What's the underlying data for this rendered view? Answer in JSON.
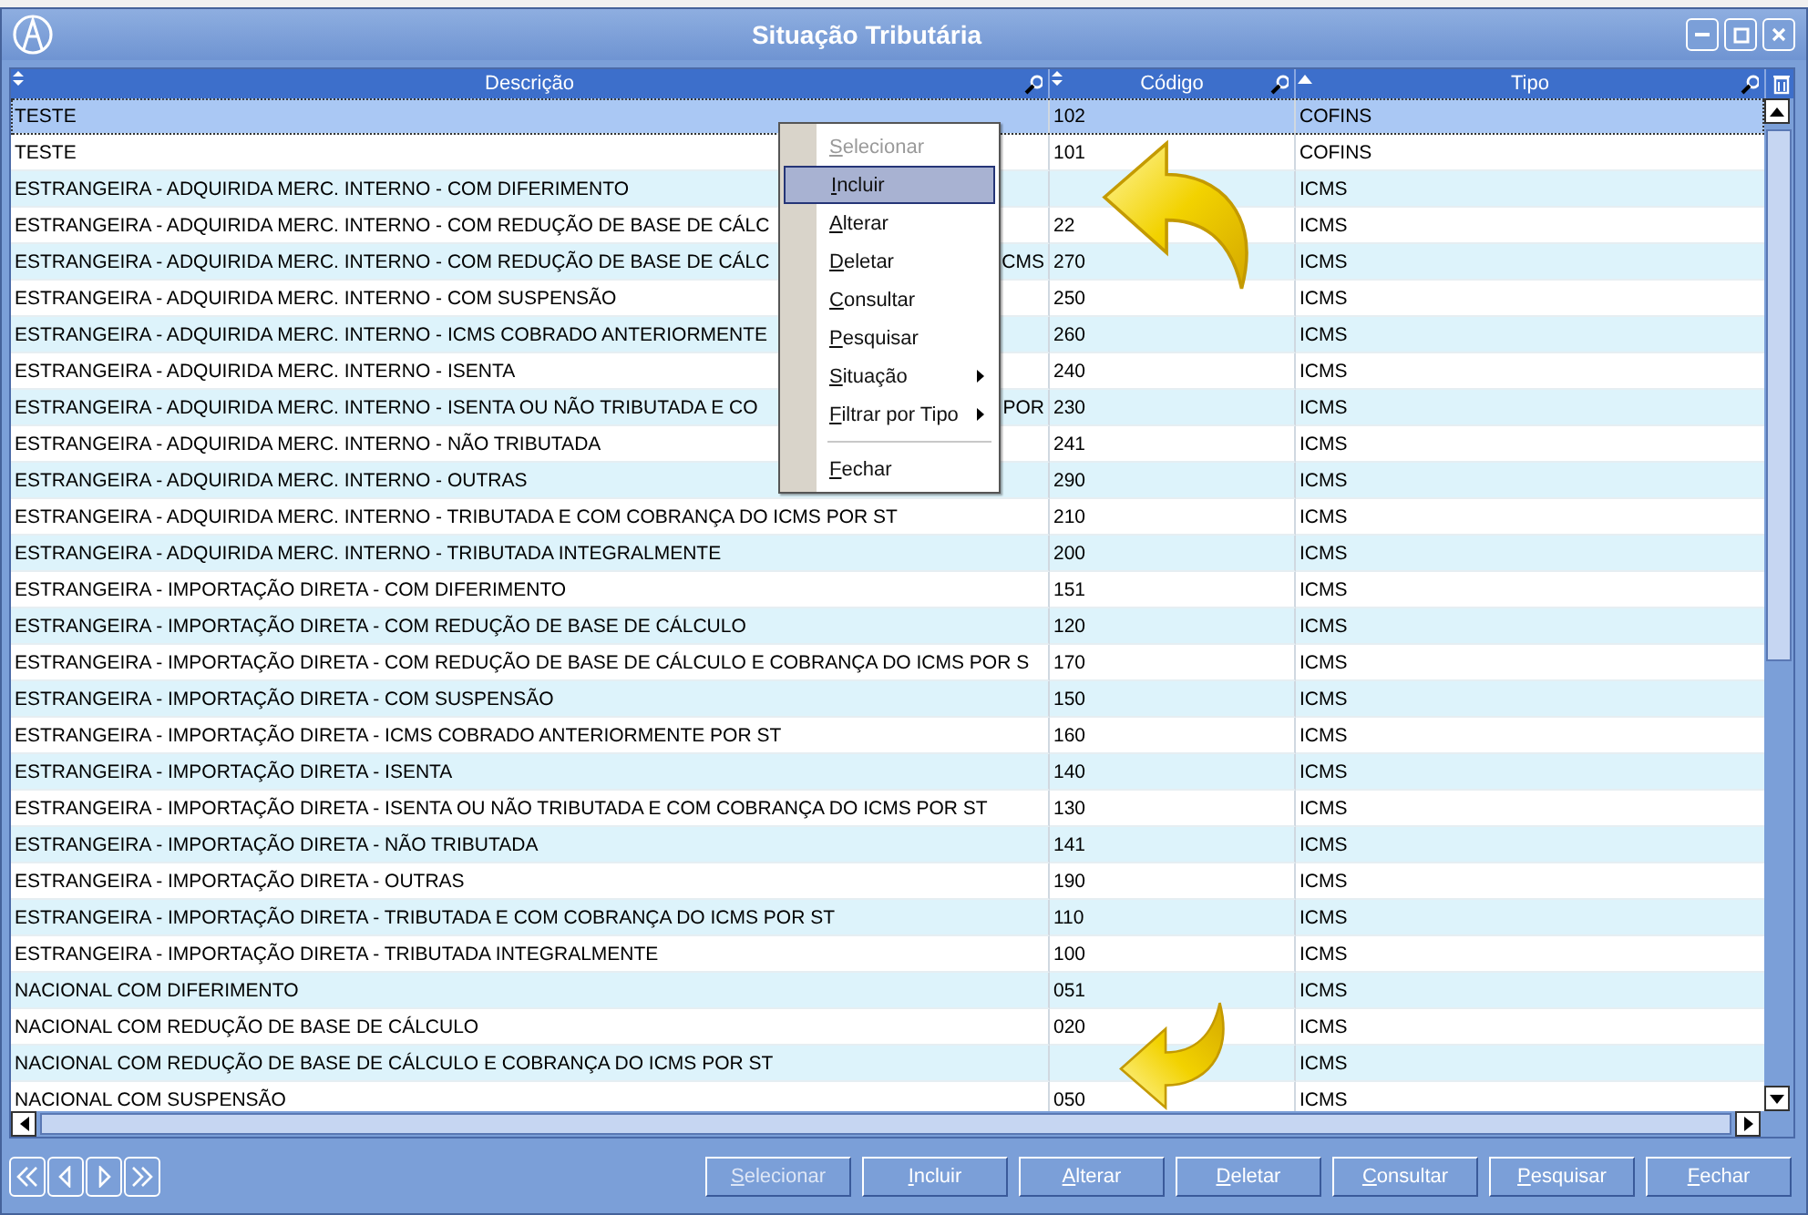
{
  "window": {
    "title": "Situação Tributária"
  },
  "table": {
    "columns": [
      {
        "label": "Descrição"
      },
      {
        "label": "Código"
      },
      {
        "label": "Tipo",
        "sorted": true
      }
    ],
    "rows": [
      {
        "description": "TESTE",
        "code": "102",
        "type": "COFINS",
        "selected": true
      },
      {
        "description": "TESTE",
        "code": "101",
        "type": "COFINS",
        "selected": false
      },
      {
        "description": "ESTRANGEIRA - ADQUIRIDA MERC. INTERNO - COM DIFERIMENTO",
        "type": "ICMS",
        "selected": false
      },
      {
        "description": "ESTRANGEIRA - ADQUIRIDA MERC. INTERNO - COM REDUÇÃO DE BASE DE CÁLC",
        "code": "22",
        "type": "ICMS",
        "selected": false
      },
      {
        "description": "ESTRANGEIRA - ADQUIRIDA MERC. INTERNO - COM REDUÇÃO DE BASE DE CÁLC",
        "description_tail": "CMS",
        "code": "270",
        "type": "ICMS",
        "selected": false
      },
      {
        "description": "ESTRANGEIRA - ADQUIRIDA MERC. INTERNO - COM SUSPENSÃO",
        "code": "250",
        "type": "ICMS",
        "selected": false
      },
      {
        "description": "ESTRANGEIRA - ADQUIRIDA MERC. INTERNO - ICMS COBRADO ANTERIORMENTE",
        "code": "260",
        "type": "ICMS",
        "selected": false
      },
      {
        "description": "ESTRANGEIRA - ADQUIRIDA MERC. INTERNO - ISENTA",
        "code": "240",
        "type": "ICMS",
        "selected": false
      },
      {
        "description": "ESTRANGEIRA - ADQUIRIDA MERC. INTERNO - ISENTA OU NÃO TRIBUTADA E CO",
        "description_tail": "POR",
        "code": "230",
        "type": "ICMS",
        "selected": false
      },
      {
        "description": "ESTRANGEIRA - ADQUIRIDA MERC. INTERNO - NÃO TRIBUTADA",
        "code": "241",
        "type": "ICMS",
        "selected": false
      },
      {
        "description": "ESTRANGEIRA - ADQUIRIDA MERC. INTERNO - OUTRAS",
        "code": "290",
        "type": "ICMS",
        "selected": false
      },
      {
        "description": "ESTRANGEIRA - ADQUIRIDA MERC. INTERNO - TRIBUTADA E COM COBRANÇA DO ICMS POR ST",
        "code": "210",
        "type": "ICMS",
        "selected": false
      },
      {
        "description": "ESTRANGEIRA - ADQUIRIDA MERC. INTERNO - TRIBUTADA INTEGRALMENTE",
        "code": "200",
        "type": "ICMS",
        "selected": false
      },
      {
        "description": "ESTRANGEIRA - IMPORTAÇÃO DIRETA - COM DIFERIMENTO",
        "code": "151",
        "type": "ICMS",
        "selected": false
      },
      {
        "description": "ESTRANGEIRA - IMPORTAÇÃO DIRETA - COM REDUÇÃO DE BASE DE CÁLCULO",
        "code": "120",
        "type": "ICMS",
        "selected": false
      },
      {
        "description": "ESTRANGEIRA - IMPORTAÇÃO DIRETA - COM REDUÇÃO DE BASE DE CÁLCULO E COBRANÇA DO ICMS POR S",
        "code": "170",
        "type": "ICMS",
        "selected": false
      },
      {
        "description": "ESTRANGEIRA - IMPORTAÇÃO DIRETA - COM SUSPENSÃO",
        "code": "150",
        "type": "ICMS",
        "selected": false
      },
      {
        "description": "ESTRANGEIRA - IMPORTAÇÃO DIRETA - ICMS COBRADO ANTERIORMENTE POR ST",
        "code": "160",
        "type": "ICMS",
        "selected": false
      },
      {
        "description": "ESTRANGEIRA - IMPORTAÇÃO DIRETA - ISENTA",
        "code": "140",
        "type": "ICMS",
        "selected": false
      },
      {
        "description": "ESTRANGEIRA - IMPORTAÇÃO DIRETA - ISENTA OU NÃO TRIBUTADA E COM COBRANÇA DO ICMS POR ST",
        "code": "130",
        "type": "ICMS",
        "selected": false
      },
      {
        "description": "ESTRANGEIRA - IMPORTAÇÃO DIRETA - NÃO TRIBUTADA",
        "code": "141",
        "type": "ICMS",
        "selected": false
      },
      {
        "description": "ESTRANGEIRA - IMPORTAÇÃO DIRETA - OUTRAS",
        "code": "190",
        "type": "ICMS",
        "selected": false
      },
      {
        "description": "ESTRANGEIRA - IMPORTAÇÃO DIRETA - TRIBUTADA E COM COBRANÇA DO ICMS POR ST",
        "code": "110",
        "type": "ICMS",
        "selected": false
      },
      {
        "description": "ESTRANGEIRA - IMPORTAÇÃO DIRETA - TRIBUTADA INTEGRALMENTE",
        "code": "100",
        "type": "ICMS",
        "selected": false
      },
      {
        "description": "NACIONAL COM DIFERIMENTO",
        "code": "051",
        "type": "ICMS",
        "selected": false
      },
      {
        "description": "NACIONAL COM REDUÇÃO DE BASE DE CÁLCULO",
        "code": "020",
        "type": "ICMS",
        "selected": false
      },
      {
        "description": "NACIONAL COM REDUÇÃO DE BASE DE CÁLCULO E COBRANÇA DO ICMS POR ST",
        "type": "ICMS",
        "selected": false
      },
      {
        "description": "NACIONAL COM SUSPENSÃO",
        "code": "050",
        "type": "ICMS",
        "selected": false
      }
    ]
  },
  "context_menu": {
    "items": [
      {
        "kind": "item",
        "label": "Selecionar",
        "disabled": true,
        "selected": false
      },
      {
        "kind": "item",
        "label": "Incluir",
        "disabled": false,
        "selected": true
      },
      {
        "kind": "item",
        "label": "Alterar",
        "disabled": false,
        "selected": false
      },
      {
        "kind": "item",
        "label": "Deletar",
        "disabled": false,
        "selected": false
      },
      {
        "kind": "item",
        "label": "Consultar",
        "disabled": false,
        "selected": false
      },
      {
        "kind": "item",
        "label": "Pesquisar",
        "disabled": false,
        "selected": false
      },
      {
        "kind": "submenu",
        "label": "Situação",
        "disabled": false,
        "selected": false
      },
      {
        "kind": "submenu",
        "label": "Filtrar por Tipo",
        "disabled": false,
        "selected": false
      },
      {
        "kind": "separator"
      },
      {
        "kind": "item",
        "label": "Fechar",
        "disabled": false,
        "selected": false
      }
    ]
  },
  "buttons": [
    {
      "label": "Selecionar",
      "disabled": true
    },
    {
      "label": "Incluir",
      "disabled": false
    },
    {
      "label": "Alterar",
      "disabled": false
    },
    {
      "label": "Deletar",
      "disabled": false
    },
    {
      "label": "Consultar",
      "disabled": false
    },
    {
      "label": "Pesquisar",
      "disabled": false
    },
    {
      "label": "Fechar",
      "disabled": false
    }
  ]
}
